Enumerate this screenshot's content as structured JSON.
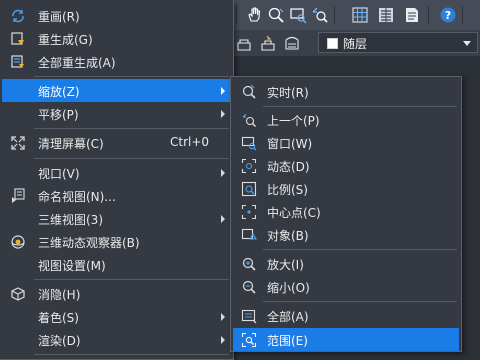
{
  "colors": {
    "background": "#2b2f36",
    "menu_bg": "#353a42",
    "highlight": "#1a7ce6",
    "text": "#eaeaea"
  },
  "view_menu": {
    "items": [
      {
        "label": "重画(R)",
        "icon": "redraw-icon"
      },
      {
        "label": "重生成(G)",
        "icon": "regen-icon"
      },
      {
        "label": "全部重生成(A)",
        "icon": "regen-all-icon"
      },
      {
        "label": "缩放(Z)",
        "submenu": true,
        "highlighted": true
      },
      {
        "label": "平移(P)",
        "submenu": true
      },
      {
        "label": "清理屏幕(C)",
        "shortcut": "Ctrl+0",
        "icon": "clean-screen-icon"
      },
      {
        "label": "视口(V)",
        "submenu": true
      },
      {
        "label": "命名视图(N)...",
        "icon": "named-view-icon"
      },
      {
        "label": "三维视图(3)",
        "submenu": true
      },
      {
        "label": "三维动态观察器(B)",
        "icon": "orbit-icon"
      },
      {
        "label": "视图设置(M)"
      },
      {
        "label": "消隐(H)",
        "icon": "hide-icon"
      },
      {
        "label": "着色(S)",
        "submenu": true
      },
      {
        "label": "渲染(D)",
        "submenu": true
      }
    ]
  },
  "zoom_menu": {
    "items": [
      {
        "label": "实时(R)",
        "icon": "zoom-realtime-icon"
      },
      {
        "label": "上一个(P)",
        "icon": "zoom-previous-icon"
      },
      {
        "label": "窗口(W)",
        "icon": "zoom-window-icon"
      },
      {
        "label": "动态(D)",
        "icon": "zoom-dynamic-icon"
      },
      {
        "label": "比例(S)",
        "icon": "zoom-scale-icon"
      },
      {
        "label": "中心点(C)",
        "icon": "zoom-center-icon"
      },
      {
        "label": "对象(B)",
        "icon": "zoom-object-icon"
      },
      {
        "label": "放大(I)",
        "icon": "zoom-in-icon"
      },
      {
        "label": "缩小(O)",
        "icon": "zoom-out-icon"
      },
      {
        "label": "全部(A)",
        "icon": "zoom-all-icon"
      },
      {
        "label": "范围(E)",
        "icon": "zoom-extents-icon",
        "highlighted": true
      }
    ]
  },
  "toolbar": {
    "icons": [
      "pan-icon",
      "zoom-realtime-icon",
      "zoom-window-icon",
      "zoom-previous-icon",
      "grid-icon",
      "properties-icon",
      "sheet-icon",
      "help-icon"
    ]
  },
  "layer_combo": {
    "value": "随层"
  }
}
